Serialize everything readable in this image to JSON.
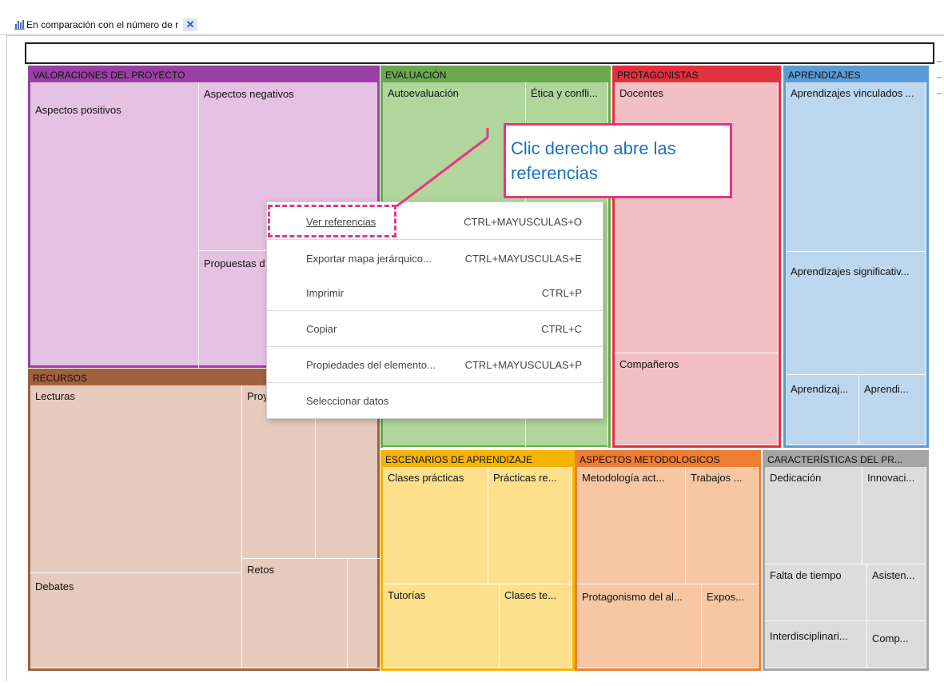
{
  "tab": {
    "icon": "treemap-chart-icon",
    "title": "En comparación con el número de r",
    "close_icon": "close-icon"
  },
  "colors": {
    "valoraciones": "#9a3fa3",
    "evaluacion": "#6aa84f",
    "protagonistas": "#e2303f",
    "aprendizajes": "#5b9bd5",
    "recursos": "#a0603c",
    "escenarios": "#f4b400",
    "metodologicos": "#ed7d31",
    "caracteristicas": "#a5a5a5",
    "highlight": "#e8348a",
    "callout_text": "#1a6fc4"
  },
  "treemap": {
    "valoraciones": {
      "header": "VALORACIONES DEL PROYECTO",
      "cells": [
        "Aspectos positivos",
        "Aspectos negativos",
        "Propuestas d"
      ]
    },
    "evaluacion": {
      "header": "EVALUACIÓN",
      "cells": [
        "Autoevaluación",
        "Ética y confli..."
      ]
    },
    "protagonistas": {
      "header": "PROTAGONISTAS",
      "cells": [
        "Docentes",
        "Compañeros"
      ]
    },
    "aprendizajes": {
      "header": "APRENDIZAJES",
      "cells": [
        "Aprendizajes vinculados ...",
        "Aprendizajes significativ...",
        "Aprendizaj...",
        "Aprendi..."
      ]
    },
    "recursos": {
      "header": "RECURSOS",
      "cells": [
        "Lecturas",
        "Proy",
        "Debates",
        "Retos"
      ]
    },
    "escenarios": {
      "header": "ESCENARIOS DE APRENDIZAJE",
      "cells": [
        "Clases prácticas",
        "Prácticas re...",
        "Tutorías",
        "Clases te..."
      ]
    },
    "metodologicos": {
      "header": "ASPECTOS METODOLOGICOS",
      "cells": [
        "Metodología act...",
        "Trabajos ...",
        "Protagonismo del al...",
        "Expos..."
      ]
    },
    "caracteristicas": {
      "header": "CARACTERÍSTICAS DEL PR...",
      "cells": [
        "Dedicación",
        "Innovaci...",
        "Falta de tiempo",
        "Asisten...",
        "Interdisciplinari...",
        "Comp..."
      ]
    }
  },
  "context_menu": {
    "items": [
      {
        "label": "Ver referencias",
        "shortcut": "CTRL+MAYUSCULAS+O"
      },
      {
        "label": "Exportar mapa jerárquico...",
        "shortcut": "CTRL+MAYUSCULAS+E"
      },
      {
        "label": "Imprimir",
        "shortcut": "CTRL+P"
      },
      {
        "label": "Copiar",
        "shortcut": "CTRL+C"
      },
      {
        "label": "Propiedades del elemento...",
        "shortcut": "CTRL+MAYUSCULAS+P"
      },
      {
        "label": "Seleccionar datos",
        "shortcut": ""
      }
    ]
  },
  "callout": {
    "text": "Clic derecho abre las referencias"
  }
}
